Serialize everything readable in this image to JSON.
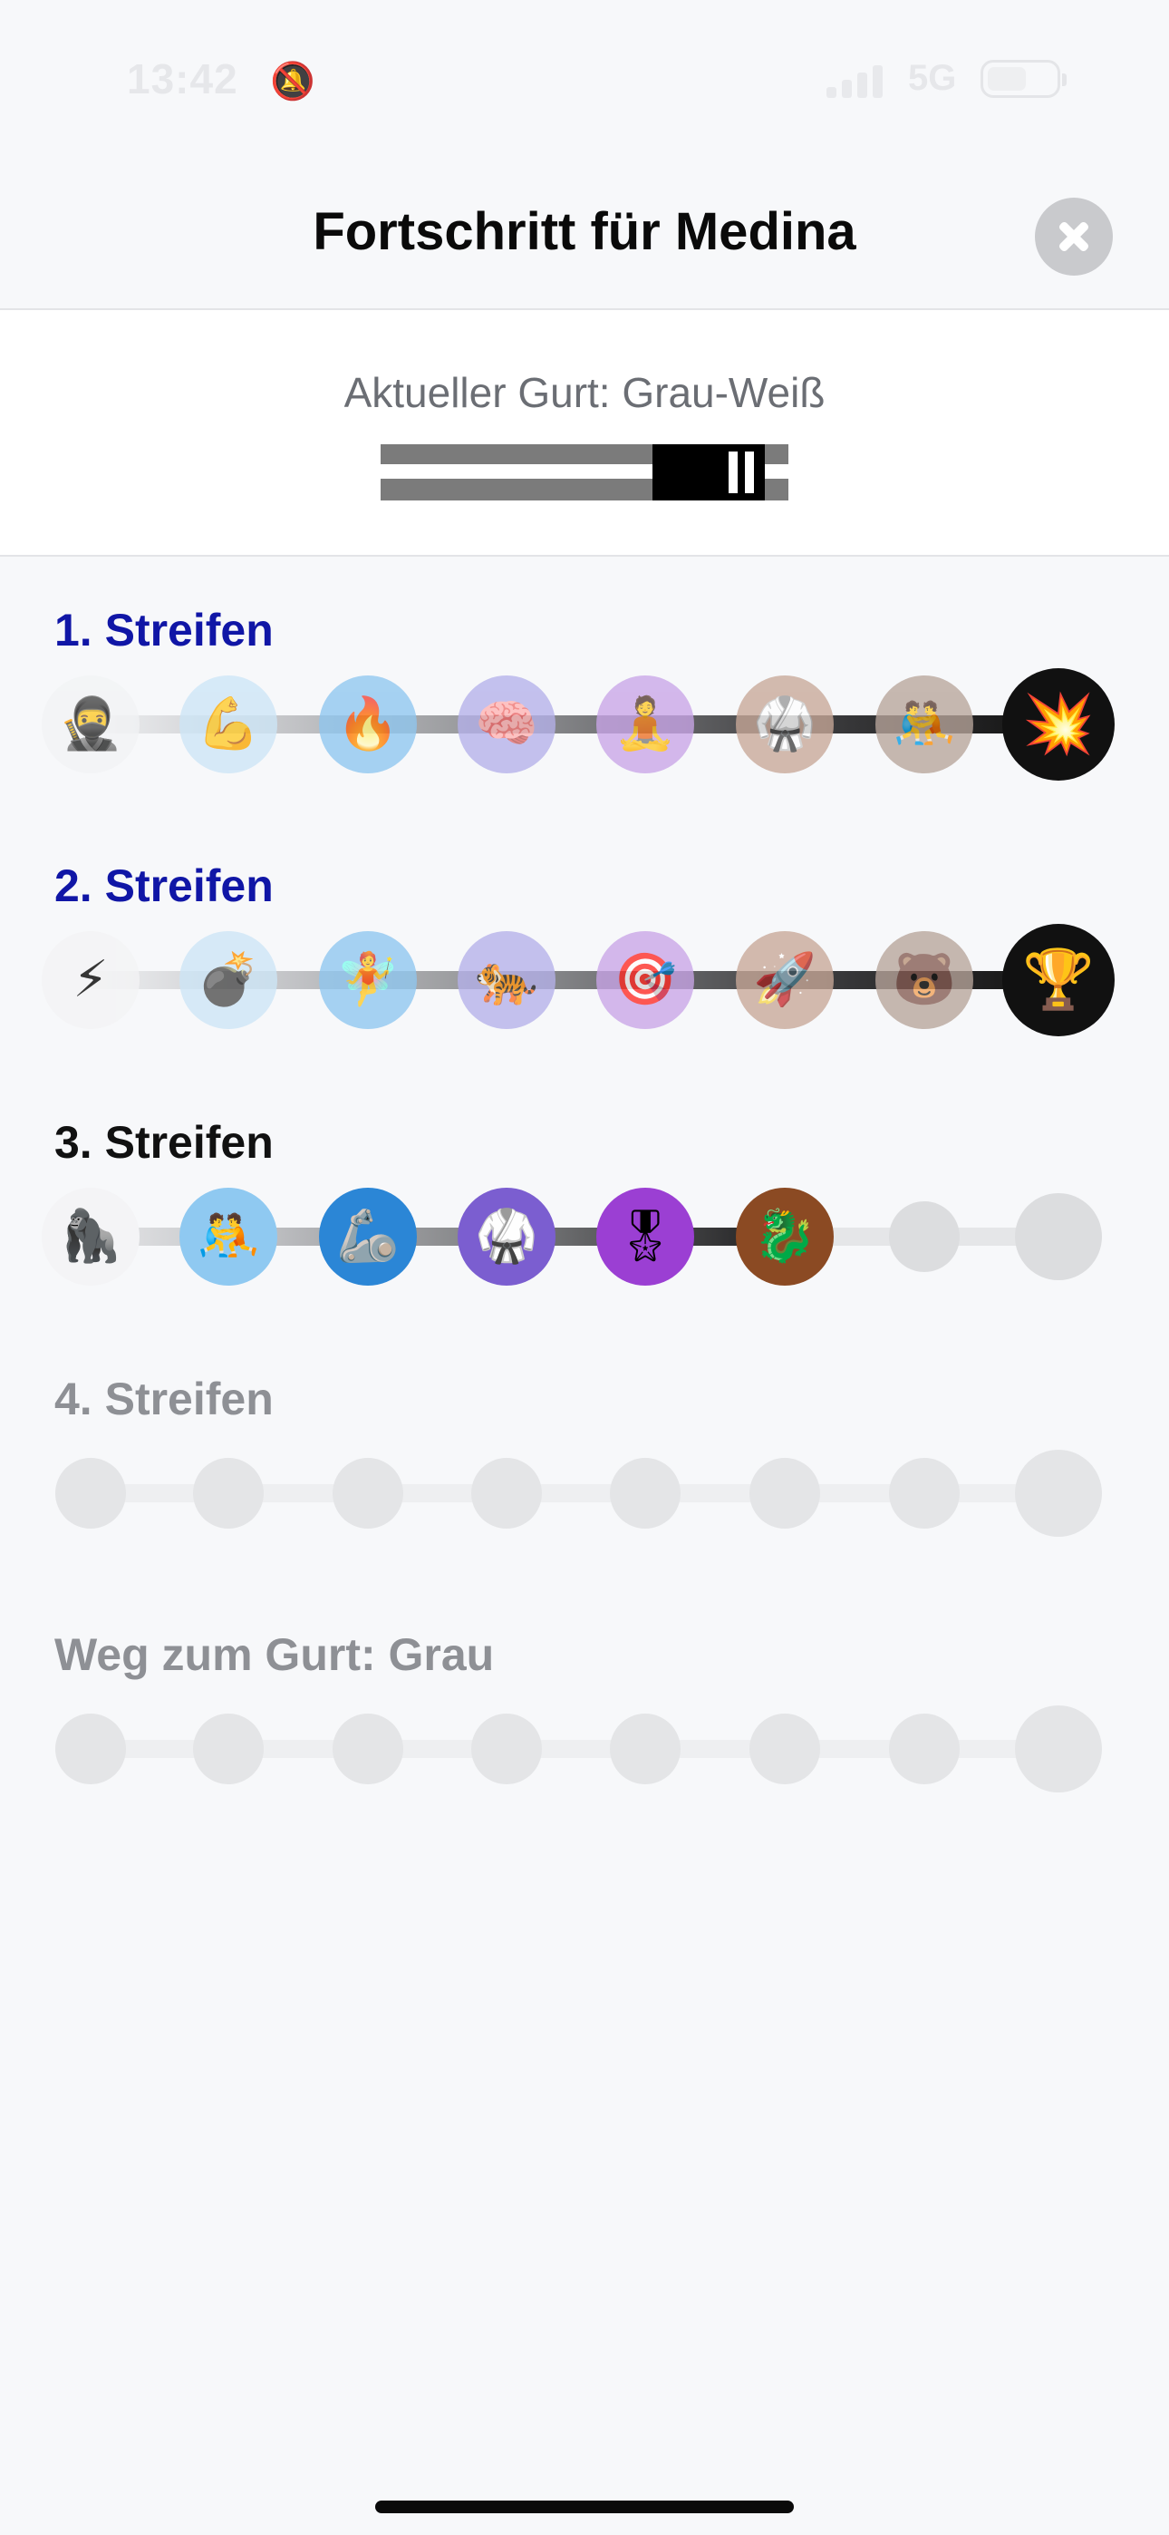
{
  "status_bar": {
    "time": "13:42",
    "network": "5G"
  },
  "header": {
    "title": "Fortschritt für Medina"
  },
  "current_belt": {
    "label": "Aktueller Gurt: Grau-Weiß",
    "stripes_shown": 2
  },
  "colors": {
    "accent": "#1016a6",
    "active_text": "#111111",
    "locked_text": "#8e9095",
    "locked_node": "#e3e4e6",
    "gold": "#d79a1f"
  },
  "sections": [
    {
      "title": "1. Streifen",
      "state": "completed",
      "nodes": [
        {
          "icon": "ninja",
          "glyph": "🥷",
          "bg": "#f2f3f5"
        },
        {
          "icon": "flexed-biceps",
          "glyph": "💪",
          "bg": "#cde6f7"
        },
        {
          "icon": "fire",
          "glyph": "🔥",
          "bg": "#8fc7f0"
        },
        {
          "icon": "brain",
          "glyph": "🧠",
          "bg": "#b5b1ea"
        },
        {
          "icon": "person-in-lotus",
          "glyph": "🧘",
          "bg": "#c9a5e8"
        },
        {
          "icon": "martial-arts-uniform",
          "glyph": "🥋",
          "bg": "#c8a898"
        },
        {
          "icon": "people-wrestling",
          "glyph": "🤼",
          "bg": "#b8a59b"
        },
        {
          "icon": "collision",
          "glyph": "💥",
          "bg": "#111111",
          "final": true
        }
      ]
    },
    {
      "title": "2. Streifen",
      "state": "completed",
      "nodes": [
        {
          "icon": "lightning",
          "glyph": "⚡",
          "bg": "#f4f4f5"
        },
        {
          "icon": "bomb",
          "glyph": "💣",
          "bg": "#cde6f7"
        },
        {
          "icon": "fairy",
          "glyph": "🧚",
          "bg": "#8fc7f0"
        },
        {
          "icon": "tiger",
          "glyph": "🐅",
          "bg": "#b5b1ea"
        },
        {
          "icon": "direct-hit",
          "glyph": "🎯",
          "bg": "#c9a5e8"
        },
        {
          "icon": "rocket",
          "glyph": "🚀",
          "bg": "#c8a898"
        },
        {
          "icon": "bear",
          "glyph": "🐻",
          "bg": "#b8a59b"
        },
        {
          "icon": "trophy",
          "glyph": "🏆",
          "bg": "#111111",
          "final": true
        }
      ]
    },
    {
      "title": "3. Streifen",
      "state": "active",
      "nodes": [
        {
          "icon": "gorilla",
          "glyph": "🦍",
          "bg": "#f4f4f6"
        },
        {
          "icon": "people-wrestling",
          "glyph": "🤼",
          "bg": "#8fc9f1"
        },
        {
          "icon": "mechanical-arm",
          "glyph": "🦾",
          "bg": "#2b86d6"
        },
        {
          "icon": "martial-arts-uniform",
          "glyph": "🥋",
          "bg": "#7b5ed0"
        },
        {
          "icon": "military-medal",
          "glyph": "🎖",
          "bg": "#9b3fd3"
        },
        {
          "icon": "dragon",
          "glyph": "🐉",
          "bg": "#8b4a23"
        },
        {
          "icon": "locked-node",
          "glyph": "",
          "bg": "#dcdddf"
        },
        {
          "icon": "locked-node",
          "glyph": "",
          "bg": "#dcdddf",
          "final": true
        }
      ]
    },
    {
      "title": "4. Streifen",
      "state": "locked",
      "nodes": [
        {
          "icon": "locked-node",
          "glyph": "",
          "bg": "#e4e5e7"
        },
        {
          "icon": "locked-node",
          "glyph": "",
          "bg": "#e4e5e7"
        },
        {
          "icon": "locked-node",
          "glyph": "",
          "bg": "#e4e5e7"
        },
        {
          "icon": "locked-node",
          "glyph": "",
          "bg": "#e4e5e7"
        },
        {
          "icon": "locked-node",
          "glyph": "",
          "bg": "#e4e5e7"
        },
        {
          "icon": "locked-node",
          "glyph": "",
          "bg": "#e4e5e7"
        },
        {
          "icon": "locked-node",
          "glyph": "",
          "bg": "#e4e5e7"
        },
        {
          "icon": "locked-node",
          "glyph": "",
          "bg": "#e4e5e7",
          "final": true
        }
      ]
    },
    {
      "title": "Weg zum Gurt: Grau",
      "state": "locked",
      "nodes": [
        {
          "icon": "locked-node",
          "glyph": "",
          "bg": "#e4e5e7"
        },
        {
          "icon": "locked-node",
          "glyph": "",
          "bg": "#e4e5e7"
        },
        {
          "icon": "locked-node",
          "glyph": "",
          "bg": "#e4e5e7"
        },
        {
          "icon": "locked-node",
          "glyph": "",
          "bg": "#e4e5e7"
        },
        {
          "icon": "locked-node",
          "glyph": "",
          "bg": "#e4e5e7"
        },
        {
          "icon": "locked-node",
          "glyph": "",
          "bg": "#e4e5e7"
        },
        {
          "icon": "locked-node",
          "glyph": "",
          "bg": "#e4e5e7"
        },
        {
          "icon": "locked-node",
          "glyph": "",
          "bg": "#e4e5e7",
          "final": true
        }
      ]
    }
  ]
}
